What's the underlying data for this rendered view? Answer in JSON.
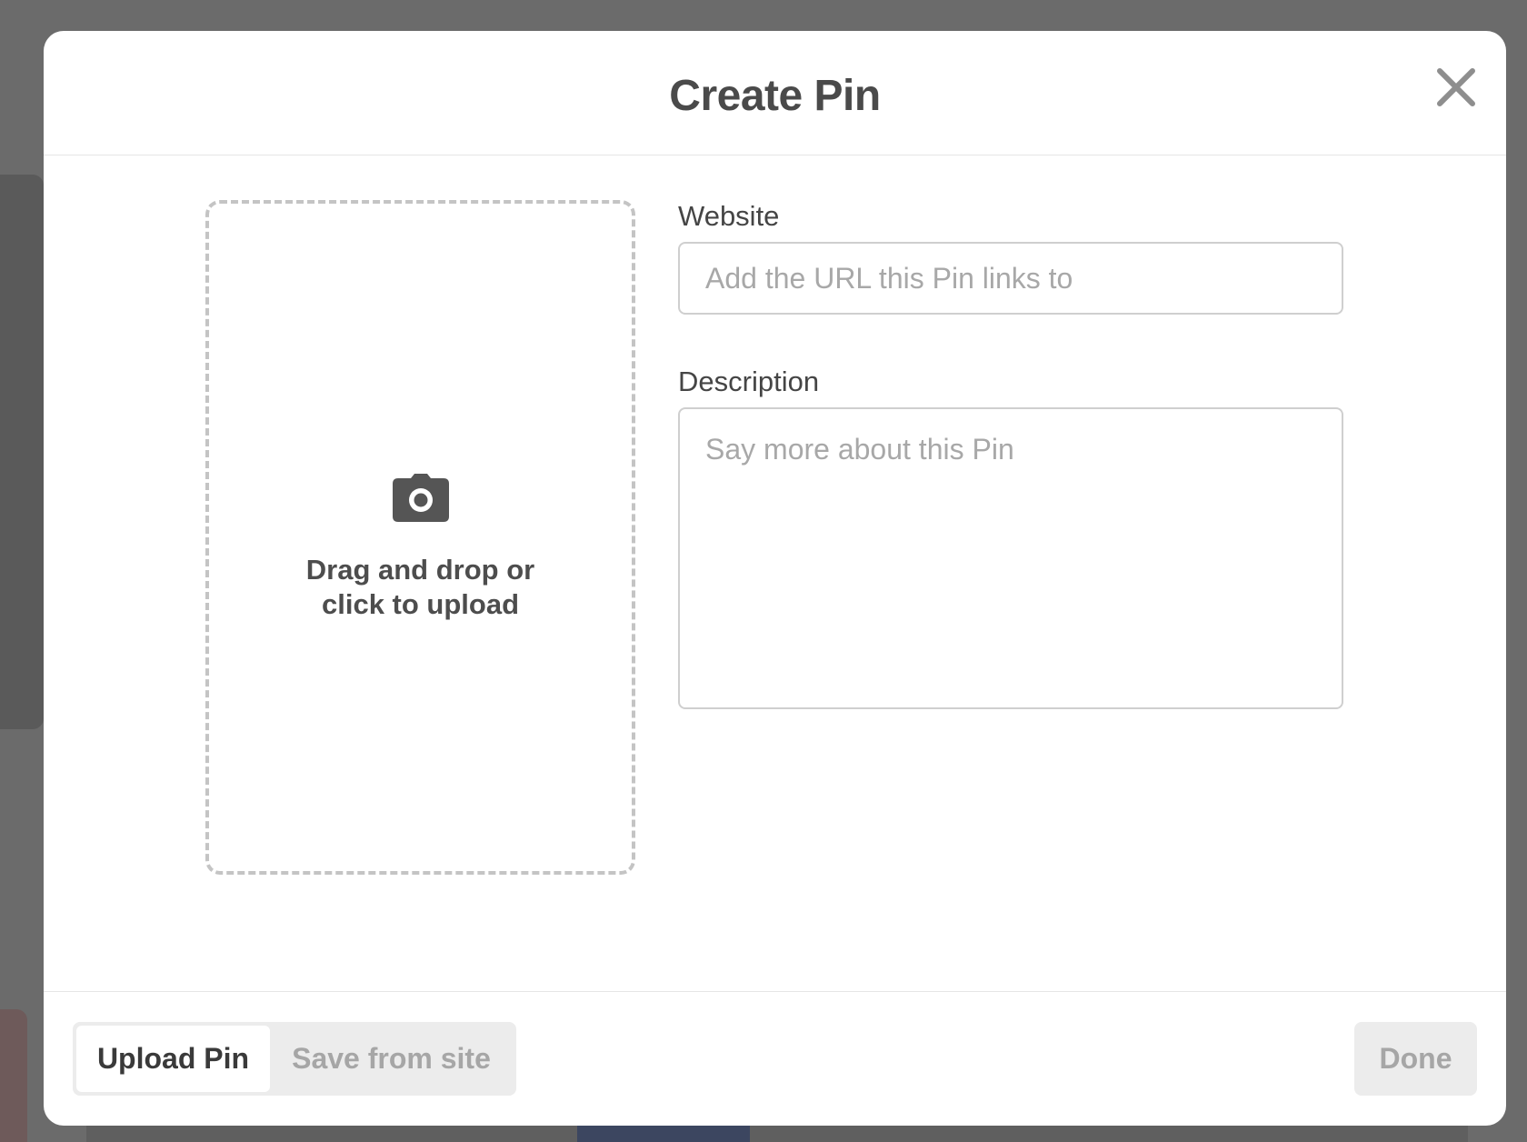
{
  "modal": {
    "title": "Create Pin",
    "close_icon": "close-icon"
  },
  "upload": {
    "icon": "camera-icon",
    "line1": "Drag and drop or",
    "line2": "click to upload"
  },
  "website": {
    "label": "Website",
    "value": "",
    "placeholder": "Add the URL this Pin links to"
  },
  "description": {
    "label": "Description",
    "value": "",
    "placeholder": "Say more about this Pin"
  },
  "footer": {
    "tabs": [
      {
        "label": "Upload Pin",
        "selected": true
      },
      {
        "label": "Save from site",
        "selected": false
      }
    ],
    "done_label": "Done",
    "done_enabled": false
  },
  "colors": {
    "overlay": "#6b6b6b",
    "text_primary": "#4a4a4a",
    "placeholder": "#a8a8a8",
    "button_bg": "#ececec",
    "disabled_text": "#a6a6a6"
  }
}
